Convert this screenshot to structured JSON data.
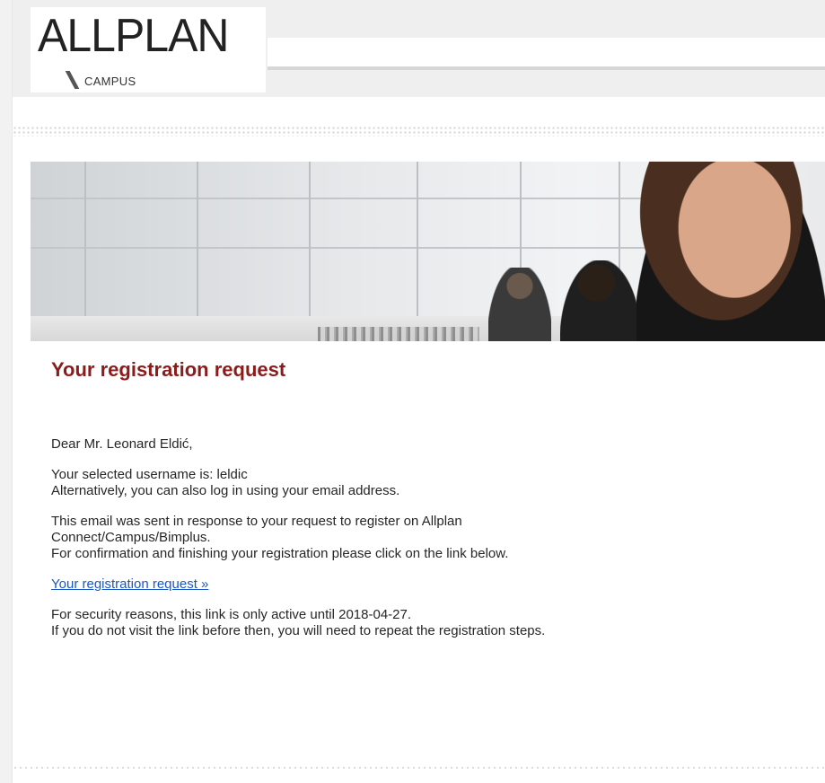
{
  "header": {
    "logo_main": "ALLPLAN",
    "logo_sub": "CAMPUS"
  },
  "email": {
    "headline": "Your registration request",
    "greeting": "Dear Mr. Leonard Eldić,",
    "username_line": "Your selected username is: leldic",
    "alt_login_line": "Alternatively, you can also log in using your email address.",
    "response_line_1": "This email was sent in response to your request to register on Allplan",
    "response_line_2": "Connect/Campus/Bimplus.",
    "confirm_line": "For confirmation and finishing your registration please click on the link below.",
    "link_label": "Your registration request »",
    "security_line": "For security reasons, this link is only active until 2018-04-27.",
    "repeat_line": "If you do not visit the link before then, you will need to repeat the registration steps."
  },
  "colors": {
    "headline": "#8c1c1c",
    "link": "#1a56c4",
    "text": "#262626"
  }
}
